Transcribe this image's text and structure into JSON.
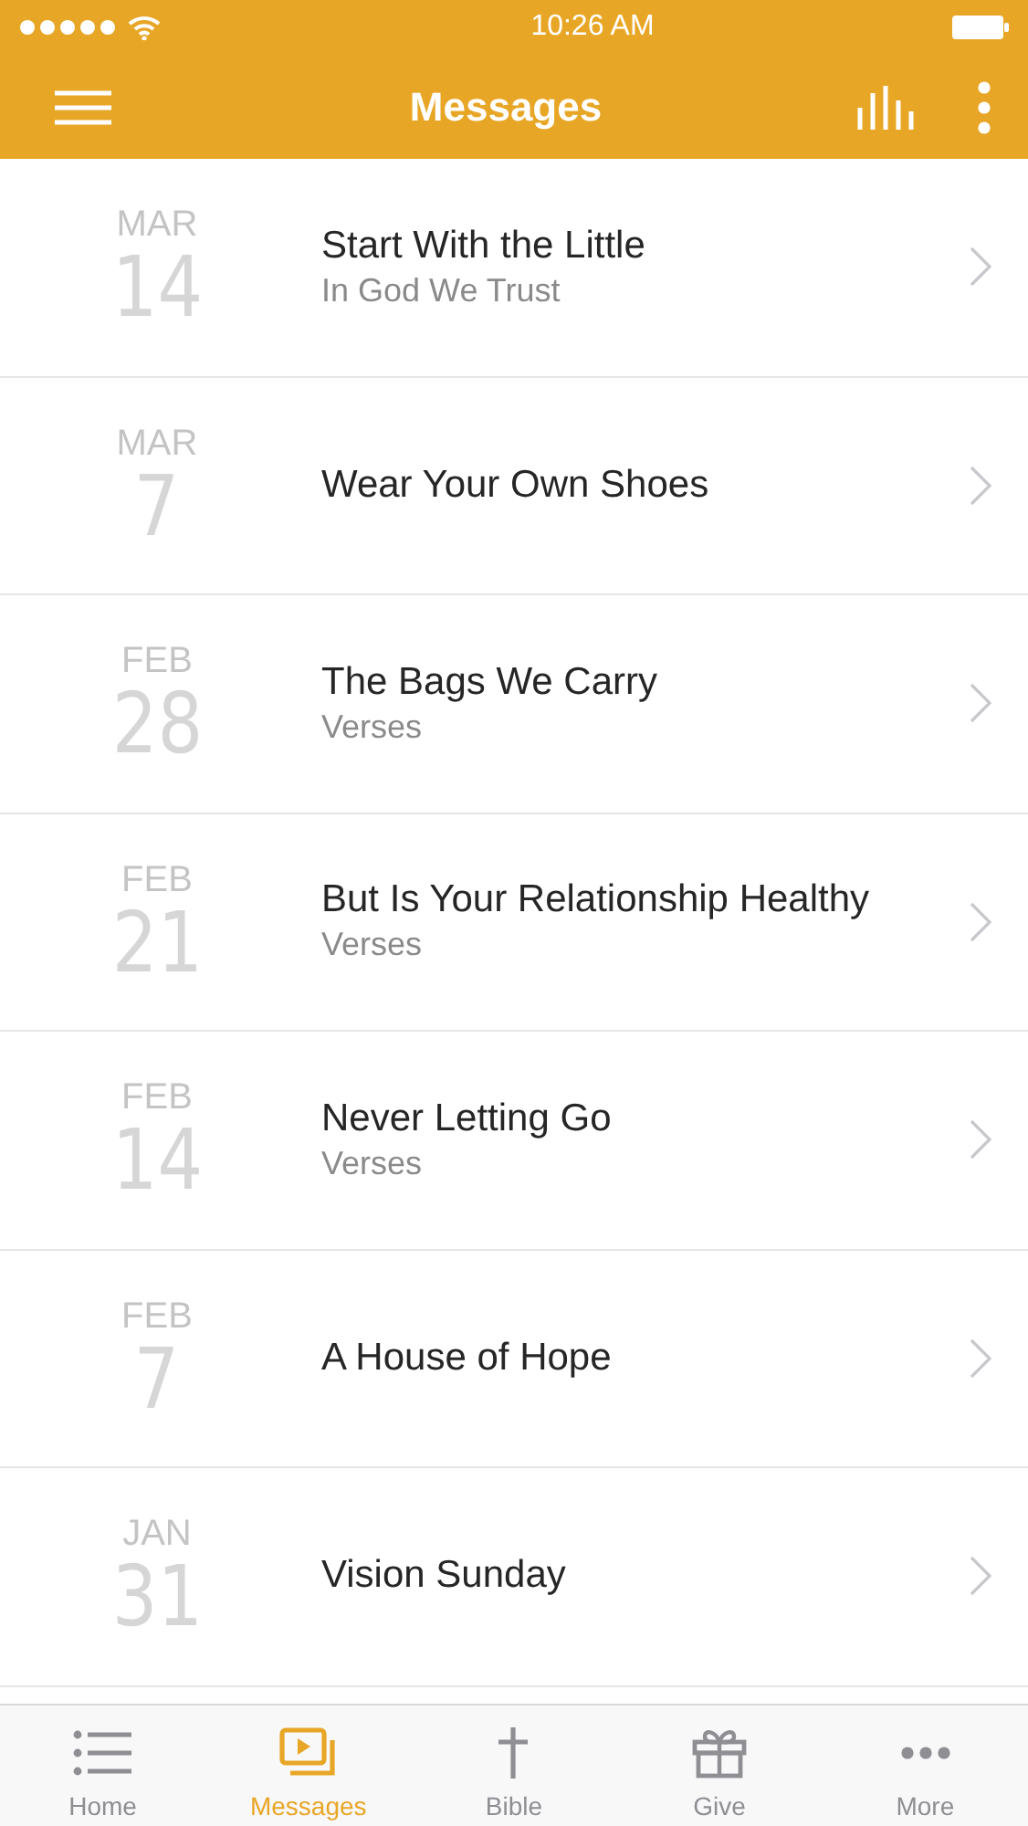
{
  "status_bar": {
    "time": "10:26 AM"
  },
  "header": {
    "title": "Messages"
  },
  "messages": [
    {
      "month": "MAR",
      "day": "14",
      "title": "Start With the Little",
      "subtitle": "In God We Trust"
    },
    {
      "month": "MAR",
      "day": "7",
      "title": "Wear Your Own Shoes"
    },
    {
      "month": "FEB",
      "day": "28",
      "title": "The Bags We Carry",
      "subtitle": "Verses"
    },
    {
      "month": "FEB",
      "day": "21",
      "title": "But Is Your Relationship Healthy",
      "subtitle": "Verses"
    },
    {
      "month": "FEB",
      "day": "14",
      "title": "Never Letting Go",
      "subtitle": "Verses"
    },
    {
      "month": "FEB",
      "day": "7",
      "title": "A House of Hope"
    },
    {
      "month": "JAN",
      "day": "31",
      "title": "Vision Sunday"
    }
  ],
  "tabs": [
    {
      "label": "Home",
      "kind": "home",
      "selected": false
    },
    {
      "label": "Messages",
      "kind": "messages",
      "selected": true
    },
    {
      "label": "Bible",
      "kind": "bible",
      "selected": false
    },
    {
      "label": "Give",
      "kind": "give",
      "selected": false
    },
    {
      "label": "More",
      "kind": "more",
      "selected": false
    }
  ]
}
